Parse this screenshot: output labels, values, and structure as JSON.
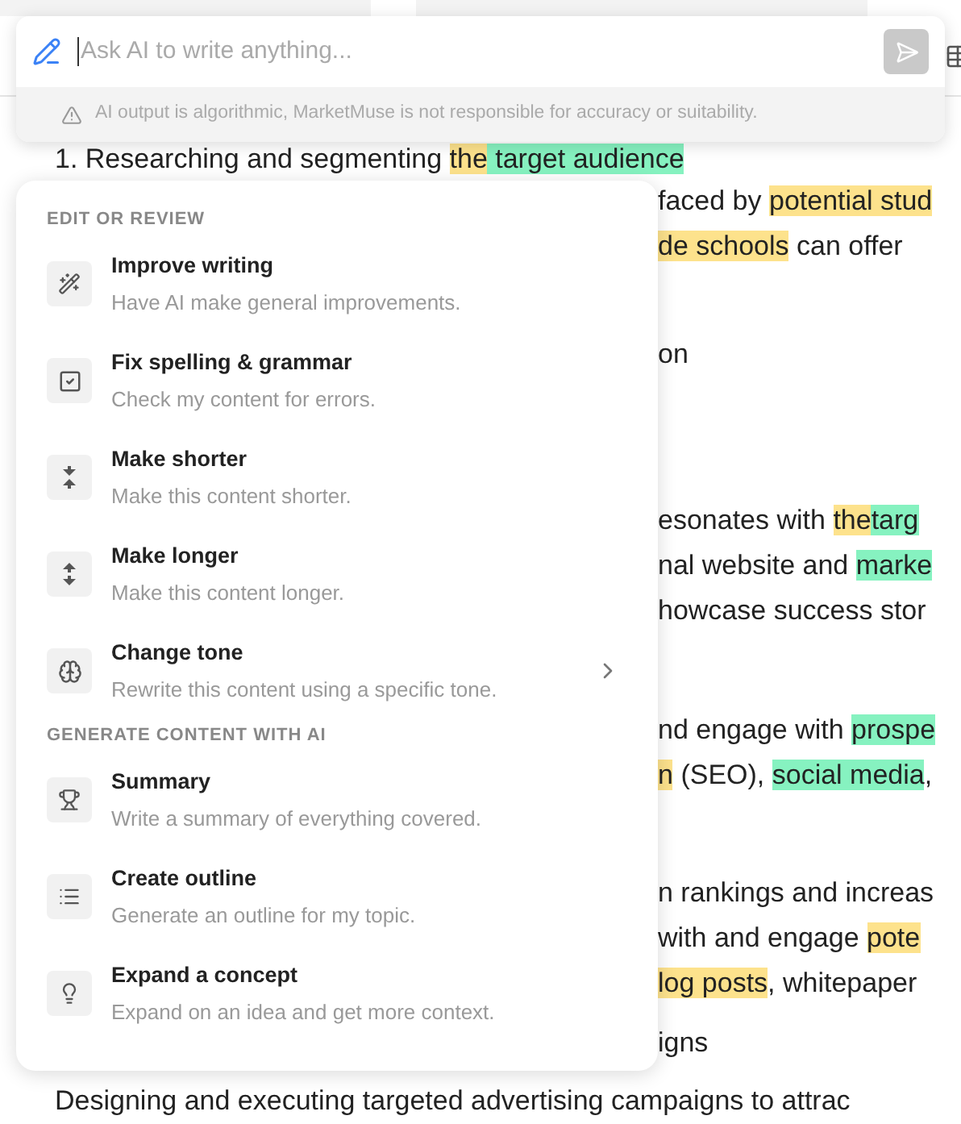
{
  "editor_lines": [
    {
      "kind": "full",
      "segments": [
        {
          "text": "1. Researching and segmenting "
        },
        {
          "text": "the",
          "color": "#fde28c"
        },
        {
          "text": " target audience",
          "color": "#86f2c0"
        }
      ]
    },
    {
      "kind": "fragment",
      "segments": [
        {
          "text": "faced by "
        },
        {
          "text": "potential stud",
          "color": "#fde28c"
        }
      ]
    },
    {
      "kind": "fragment",
      "segments": [
        {
          "text": "de schools",
          "color": "#fde28c"
        },
        {
          "text": " can offer"
        }
      ]
    },
    {
      "kind": "fragment",
      "segments": [
        {
          "text": "on"
        }
      ]
    },
    {
      "kind": "fragment",
      "segments": [
        {
          "text": "esonates with "
        },
        {
          "text": "the",
          "color": "#fde28c"
        },
        {
          "text": "targ",
          "color": "#86f2c0"
        }
      ]
    },
    {
      "kind": "fragment",
      "segments": [
        {
          "text": "nal website and "
        },
        {
          "text": "marke",
          "color": "#86f2c0"
        }
      ]
    },
    {
      "kind": "fragment",
      "segments": [
        {
          "text": "howcase success stor"
        }
      ]
    },
    {
      "kind": "fragment",
      "segments": [
        {
          "text": "nd engage with "
        },
        {
          "text": "prospe",
          "color": "#86f2c0"
        }
      ]
    },
    {
      "kind": "fragment",
      "segments": [
        {
          "text": "n",
          "color": "#fde28c"
        },
        {
          "text": " (SEO), "
        },
        {
          "text": "social media",
          "color": "#86f2c0"
        },
        {
          "text": ", "
        }
      ]
    },
    {
      "kind": "fragment",
      "segments": [
        {
          "text": "n rankings and increas"
        }
      ]
    },
    {
      "kind": "fragment",
      "segments": [
        {
          "text": " with and engage "
        },
        {
          "text": "pote",
          "color": "#fde28c"
        }
      ]
    },
    {
      "kind": "fragment",
      "segments": [
        {
          "text": "log posts",
          "color": "#fde28c"
        },
        {
          "text": ", whitepaper"
        }
      ]
    },
    {
      "kind": "fragment",
      "segments": [
        {
          "text": "igns"
        }
      ]
    },
    {
      "kind": "full",
      "segments": [
        {
          "text": "Designing and executing targeted advertising campaigns to attrac"
        }
      ]
    }
  ],
  "ai_bar": {
    "placeholder": "Ask AI to write anything...",
    "disclaimer": "AI output is algorithmic, MarketMuse is not responsible for accuracy or suitability."
  },
  "menu": {
    "sections": [
      {
        "title": "EDIT OR REVIEW",
        "items": [
          {
            "kind": "wand",
            "title": "Improve writing",
            "description": "Have AI make general improvements.",
            "submenu": false
          },
          {
            "kind": "check",
            "title": "Fix spelling & grammar",
            "description": "Check my content for errors.",
            "submenu": false
          },
          {
            "kind": "shorter",
            "title": "Make shorter",
            "description": "Make this content shorter.",
            "submenu": false
          },
          {
            "kind": "longer",
            "title": "Make longer",
            "description": "Make this content longer.",
            "submenu": false
          },
          {
            "kind": "tone",
            "title": "Change tone",
            "description": "Rewrite this content using a specific tone.",
            "submenu": true
          }
        ]
      },
      {
        "title": "GENERATE CONTENT WITH AI",
        "items": [
          {
            "kind": "trophy",
            "title": "Summary",
            "description": "Write a summary of everything covered.",
            "submenu": false
          },
          {
            "kind": "list",
            "title": "Create outline",
            "description": "Generate an outline for my topic.",
            "submenu": false
          },
          {
            "kind": "bulb",
            "title": "Expand a concept",
            "description": "Expand on an idea and get more context.",
            "submenu": false
          }
        ]
      }
    ]
  }
}
